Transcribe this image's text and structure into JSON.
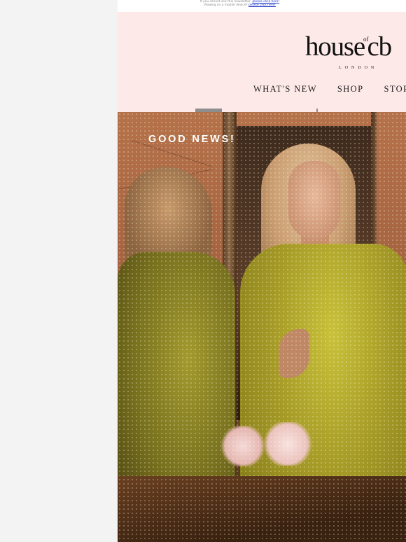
{
  "preheader": {
    "line1_text": "If you cannot see this newsletter,",
    "line1_link": "please click here!",
    "line2_text": "Viewing on a mobile device?",
    "line2_link": "please click here!"
  },
  "brand": {
    "logo_main": "house",
    "logo_of": "of",
    "logo_tail": "cb",
    "logo_sub": "LONDON"
  },
  "nav": {
    "items": [
      "WHAT'S NEW",
      "SHOP",
      "STORES"
    ]
  },
  "hero": {
    "headline": "GOOD NEWS!"
  },
  "colors": {
    "page_bg": "#f3f3f3",
    "header_bg": "#fde9e8",
    "link_blue": "#1a36c9",
    "text_dark": "#111111"
  }
}
